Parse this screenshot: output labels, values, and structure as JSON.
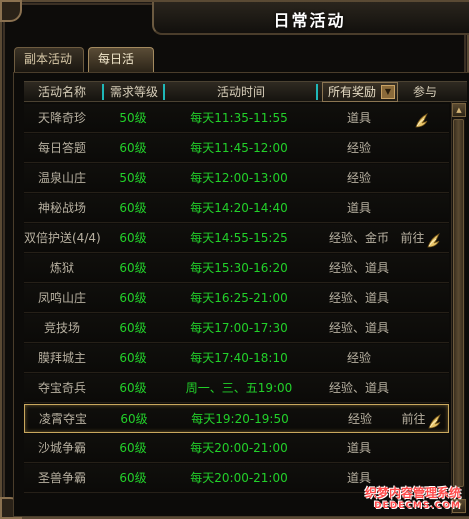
{
  "window": {
    "title": "日常活动"
  },
  "tabs": [
    {
      "label": "副本活动",
      "active": false
    },
    {
      "label": "每日活动",
      "active": true
    }
  ],
  "table": {
    "headers": {
      "name": "活动名称",
      "level": "需求等级",
      "time": "活动时间",
      "reward_filter": "所有奖励",
      "join": "参与"
    },
    "rows": [
      {
        "name": "天降奇珍",
        "level": "50级",
        "time": "每天11:35-11:55",
        "reward": "道具",
        "go_label": "",
        "wing_icon": true,
        "selected": false
      },
      {
        "name": "每日答题",
        "level": "60级",
        "time": "每天11:45-12:00",
        "reward": "经验",
        "go_label": "",
        "wing_icon": false,
        "selected": false
      },
      {
        "name": "温泉山庄",
        "level": "50级",
        "time": "每天12:00-13:00",
        "reward": "经验",
        "go_label": "",
        "wing_icon": false,
        "selected": false
      },
      {
        "name": "神秘战场",
        "level": "60级",
        "time": "每天14:20-14:40",
        "reward": "道具",
        "go_label": "",
        "wing_icon": false,
        "selected": false
      },
      {
        "name": "双倍护送(4/4)",
        "level": "60级",
        "time": "每天14:55-15:25",
        "reward": "经验、金币",
        "go_label": "前往",
        "wing_icon": true,
        "selected": false
      },
      {
        "name": "炼狱",
        "level": "60级",
        "time": "每天15:30-16:20",
        "reward": "经验、道具",
        "go_label": "",
        "wing_icon": false,
        "selected": false
      },
      {
        "name": "凤鸣山庄",
        "level": "60级",
        "time": "每天16:25-21:00",
        "reward": "经验、道具",
        "go_label": "",
        "wing_icon": false,
        "selected": false
      },
      {
        "name": "竞技场",
        "level": "60级",
        "time": "每天17:00-17:30",
        "reward": "经验、道具",
        "go_label": "",
        "wing_icon": false,
        "selected": false
      },
      {
        "name": "膜拜城主",
        "level": "60级",
        "time": "每天17:40-18:10",
        "reward": "经验",
        "go_label": "",
        "wing_icon": false,
        "selected": false
      },
      {
        "name": "夺宝奇兵",
        "level": "60级",
        "time": "周一、三、五19:00",
        "reward": "经验、道具",
        "go_label": "",
        "wing_icon": false,
        "selected": false
      },
      {
        "name": "凌霄夺宝",
        "level": "60级",
        "time": "每天19:20-19:50",
        "reward": "经验",
        "go_label": "前往",
        "wing_icon": true,
        "selected": true
      },
      {
        "name": "沙城争霸",
        "level": "60级",
        "time": "每天20:00-21:00",
        "reward": "道具",
        "go_label": "",
        "wing_icon": false,
        "selected": false
      },
      {
        "name": "圣兽争霸",
        "level": "60级",
        "time": "每天20:00-21:00",
        "reward": "道具",
        "go_label": "",
        "wing_icon": false,
        "selected": false
      }
    ]
  },
  "watermark": {
    "line1": "织梦内容管理系统",
    "line2": "DEDECMS.COM"
  },
  "colors": {
    "green_text": "#22d02a",
    "gold_border": "#c9a85e",
    "header_separator": "#1fb8b8"
  }
}
